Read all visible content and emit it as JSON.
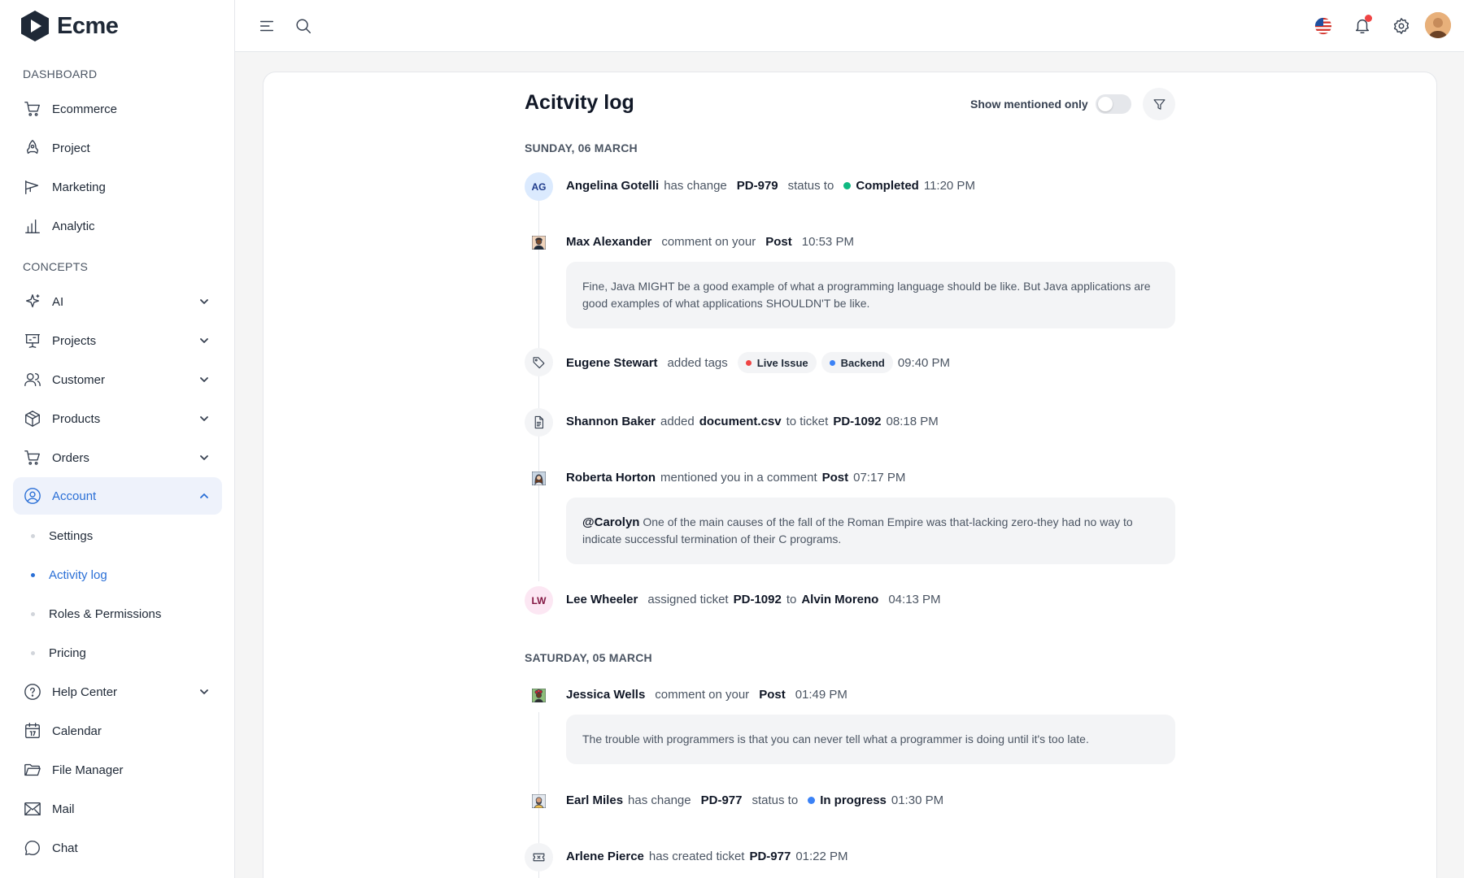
{
  "app": {
    "name": "Ecme"
  },
  "sidebar": {
    "sections": {
      "dashboard": "DASHBOARD",
      "concepts": "CONCEPTS"
    },
    "dashboard_items": [
      {
        "label": "Ecommerce",
        "icon": "cart-icon"
      },
      {
        "label": "Project",
        "icon": "rocket-icon"
      },
      {
        "label": "Marketing",
        "icon": "megaphone-icon"
      },
      {
        "label": "Analytic",
        "icon": "bar-chart-icon"
      }
    ],
    "concept_items": [
      {
        "label": "AI",
        "icon": "sparkle-icon",
        "expandable": true
      },
      {
        "label": "Projects",
        "icon": "presentation-icon",
        "expandable": true
      },
      {
        "label": "Customer",
        "icon": "users-icon",
        "expandable": true
      },
      {
        "label": "Products",
        "icon": "box-icon",
        "expandable": true
      },
      {
        "label": "Orders",
        "icon": "cart-icon",
        "expandable": true
      },
      {
        "label": "Account",
        "icon": "user-circle-icon",
        "expandable": true,
        "expanded": true,
        "active": true
      },
      {
        "label": "Help Center",
        "icon": "help-icon",
        "expandable": true
      },
      {
        "label": "Calendar",
        "icon": "calendar-icon"
      },
      {
        "label": "File Manager",
        "icon": "folder-icon"
      },
      {
        "label": "Mail",
        "icon": "mail-icon"
      },
      {
        "label": "Chat",
        "icon": "chat-icon"
      }
    ],
    "account_sub_items": [
      {
        "label": "Settings"
      },
      {
        "label": "Activity log",
        "active": true
      },
      {
        "label": "Roles & Permissions"
      },
      {
        "label": "Pricing"
      }
    ]
  },
  "header": {
    "icons": [
      "menu-icon",
      "search-icon",
      "us-flag-icon",
      "bell-icon",
      "gear-icon",
      "avatar"
    ]
  },
  "page": {
    "title": "Acitvity log",
    "mention_toggle_label": "Show mentioned only",
    "mention_toggle_on": false
  },
  "colors": {
    "accent": "#2a6fd6",
    "completed": "#10b981",
    "in_progress": "#3b82f6",
    "live_issue": "#ef4444",
    "backend": "#3b82f6"
  },
  "groups": [
    {
      "date": "SUNDAY, 06 MARCH",
      "events": [
        {
          "initials": "AG",
          "user": "Angelina Gotelli",
          "action": "has change",
          "ticket": "PD-979",
          "action2": "status to",
          "status": "Completed",
          "time": "11:20 PM"
        },
        {
          "user": "Max Alexander",
          "action": "comment on your",
          "target": "Post",
          "time": "10:53 PM",
          "comment": "Fine, Java MIGHT be a good example of what a programming language should be like. But Java applications are good examples of what applications SHOULDN'T be like."
        },
        {
          "icon": "tag-icon",
          "user": "Eugene Stewart",
          "action": "added tags",
          "tags": [
            "Live Issue",
            "Backend"
          ],
          "time": "09:40 PM"
        },
        {
          "icon": "document-icon",
          "user": "Shannon Baker",
          "action": "added",
          "file": "document.csv",
          "action2": "to ticket",
          "ticket": "PD-1092",
          "time": "08:18 PM"
        },
        {
          "user": "Roberta Horton",
          "action": "mentioned you in a comment",
          "target": "Post",
          "time": "07:17 PM",
          "mention": "@Carolyn",
          "comment": "One of the main causes of the fall of the Roman Empire was that-lacking zero-they had no way to indicate successful termination of their C programs."
        },
        {
          "initials": "LW",
          "user": "Lee Wheeler",
          "action": "assigned ticket",
          "ticket": "PD-1092",
          "action2": "to",
          "assignee": "Alvin Moreno",
          "time": "04:13 PM"
        }
      ]
    },
    {
      "date": "SATURDAY, 05 MARCH",
      "events": [
        {
          "user": "Jessica Wells",
          "action": "comment on your",
          "target": "Post",
          "time": "01:49 PM",
          "comment": "The trouble with programmers is that you can never tell what a programmer is doing until it's too late."
        },
        {
          "user": "Earl Miles",
          "action": "has change",
          "ticket": "PD-977",
          "action2": "status to",
          "status": "In progress",
          "time": "01:30 PM"
        },
        {
          "icon": "ticket-icon",
          "user": "Arlene Pierce",
          "action": "has created ticket",
          "ticket": "PD-977",
          "time": "01:22 PM"
        }
      ]
    }
  ]
}
